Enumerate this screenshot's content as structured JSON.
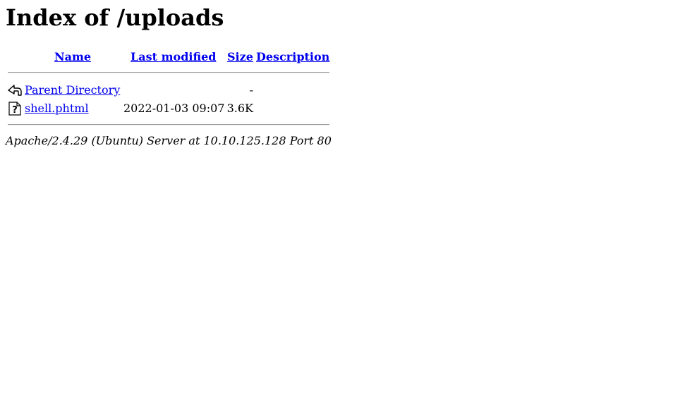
{
  "title": "Index of /uploads",
  "columns": {
    "name": "Name",
    "last_modified": "Last modified",
    "size": "Size",
    "description": "Description"
  },
  "rows": [
    {
      "icon": "back-icon",
      "name": "Parent Directory",
      "last_modified": "",
      "size": "-",
      "description": ""
    },
    {
      "icon": "unknown-file-icon",
      "name": "shell.phtml",
      "last_modified": "2022-01-03 09:07",
      "size": "3.6K",
      "description": ""
    }
  ],
  "footer": "Apache/2.4.29 (Ubuntu) Server at 10.10.125.128 Port 80",
  "colors": {
    "link": "#0000ee",
    "text": "#000000",
    "background": "#ffffff"
  }
}
